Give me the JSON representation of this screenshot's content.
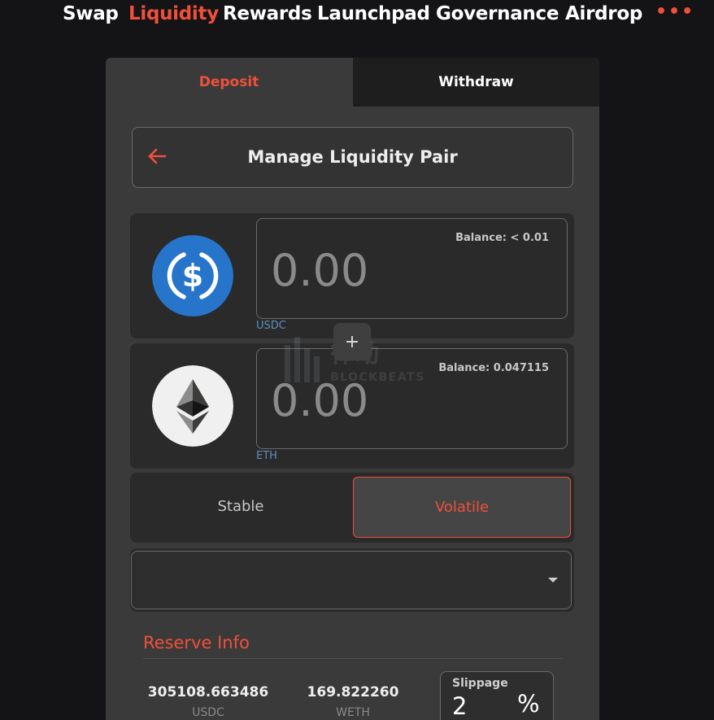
{
  "nav": {
    "items": [
      {
        "label": "Swap",
        "active": false
      },
      {
        "label": "Liquidity",
        "active": true
      },
      {
        "label": "Rewards",
        "active": false
      },
      {
        "label": "Launchpad",
        "active": false
      },
      {
        "label": "Governance",
        "active": false
      },
      {
        "label": "Airdrop",
        "active": false
      }
    ],
    "more_label": "•••"
  },
  "tabs": {
    "deposit": "Deposit",
    "withdraw": "Withdraw",
    "active": "Deposit"
  },
  "manage": {
    "title": "Manage Liquidity Pair",
    "back_icon": "arrow-left-icon"
  },
  "tokens": [
    {
      "symbol": "USDC",
      "balance": "Balance: < 0.01",
      "amount_value": "",
      "amount_placeholder": "0.00",
      "logo_icon": "usdc-logo-icon"
    },
    {
      "symbol": "ETH",
      "balance": "Balance: 0.047115",
      "amount_value": "",
      "amount_placeholder": "0.00",
      "logo_icon": "eth-logo-icon"
    }
  ],
  "plus_label": "+",
  "pool_type": {
    "stable": "Stable",
    "volatile": "Volatile",
    "selected": "Volatile"
  },
  "pair_select": {
    "value": ""
  },
  "reserve": {
    "title": "Reserve Info",
    "items": [
      {
        "value": "305108.663486",
        "unit": "USDC"
      },
      {
        "value": "169.822260",
        "unit": "WETH"
      }
    ]
  },
  "slippage": {
    "label": "Slippage",
    "value": "2",
    "unit": "%"
  },
  "watermark": {
    "line1": "律动",
    "line2": "BLOCKBEATS"
  },
  "colors": {
    "accent": "#f0503a",
    "background": "#141416",
    "panel": "#3a3a3a",
    "card": "#2a2a2a",
    "usdc_blue": "#2775ca"
  }
}
